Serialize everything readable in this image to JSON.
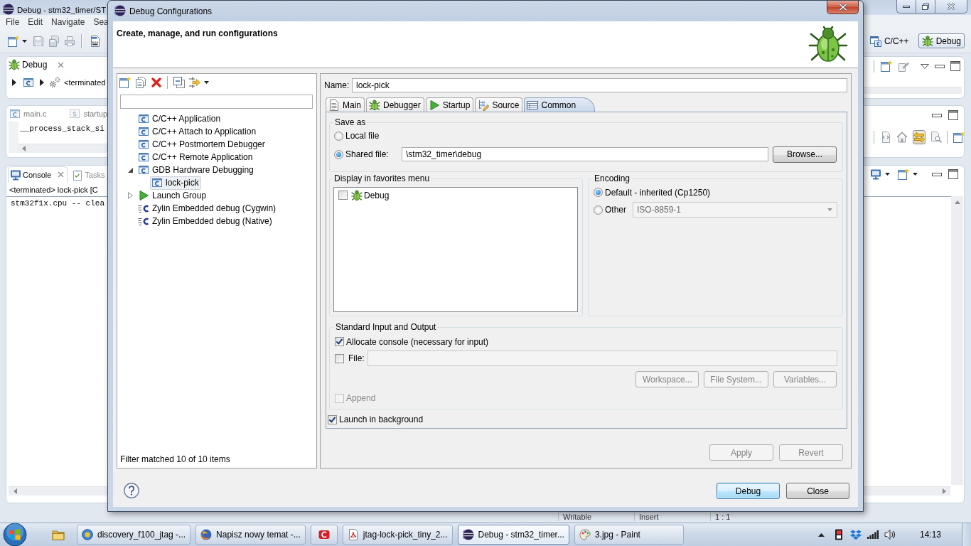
{
  "ide": {
    "title": "Debug - stm32_timer/ST",
    "menu": [
      "File",
      "Edit",
      "Navigate",
      "Sea"
    ],
    "perspectives": [
      {
        "label": "C/C++",
        "selected": false
      },
      {
        "label": "Debug",
        "selected": true
      }
    ],
    "debug_view": {
      "tab": "Debug",
      "breadcrumb": "<terminated"
    },
    "editor": {
      "tabs": [
        "main.c",
        "startup"
      ],
      "code": "__process_stack_si"
    },
    "arrows_toggle": {
      "on": true
    },
    "console": {
      "tabs": [
        {
          "label": "Console",
          "selected": true
        },
        {
          "label": "Tasks",
          "selected": false
        }
      ],
      "header": "<terminated> lock-pick [C",
      "lines": [
        "stm32f1x.cpu -- clea"
      ]
    },
    "status_bar": [
      "Writable",
      "Insert",
      "1 : 1"
    ]
  },
  "dialog": {
    "title": "Debug Configurations",
    "heading": "Create, manage, and run configurations",
    "tree": [
      {
        "label": "C/C++ Application",
        "kind": "cdt",
        "selected": false
      },
      {
        "label": "C/C++ Attach to Application",
        "kind": "cdt",
        "selected": false
      },
      {
        "label": "C/C++ Postmortem Debugger",
        "kind": "cdt",
        "selected": false
      },
      {
        "label": "C/C++ Remote Application",
        "kind": "cdt",
        "selected": false
      },
      {
        "label": "GDB Hardware Debugging",
        "kind": "cdt",
        "expanded": true,
        "selected": false,
        "children": [
          {
            "label": "lock-pick",
            "kind": "cdt",
            "selected": true
          }
        ]
      },
      {
        "label": "Launch Group",
        "kind": "group",
        "expanded": false,
        "selected": false
      },
      {
        "label": "Zylin Embedded debug (Cygwin)",
        "kind": "zylin",
        "selected": false
      },
      {
        "label": "Zylin Embedded debug (Native)",
        "kind": "zylin",
        "selected": false
      }
    ],
    "filter_status": "Filter matched 10 of 10 items",
    "name": {
      "label": "Name:",
      "value": "lock-pick"
    },
    "tabs": [
      {
        "label": "Main",
        "selected": false
      },
      {
        "label": "Debugger",
        "selected": false
      },
      {
        "label": "Startup",
        "selected": false
      },
      {
        "label": "Source",
        "selected": false
      },
      {
        "label": "Common",
        "selected": true
      }
    ],
    "save_as": {
      "title": "Save as",
      "options": [
        {
          "label": "Local file",
          "selected": false
        },
        {
          "label": "Shared file:",
          "selected": true
        }
      ],
      "path": "\\stm32_timer\\debug",
      "browse": "Browse..."
    },
    "favorites": {
      "title": "Display in favorites menu",
      "items": [
        {
          "label": "Debug",
          "checked": false
        }
      ]
    },
    "encoding": {
      "title": "Encoding",
      "options": [
        {
          "label": "Default - inherited (Cp1250)",
          "selected": true
        },
        {
          "label": "Other",
          "selected": false
        }
      ],
      "other_value": "ISO-8859-1"
    },
    "std_io": {
      "title": "Standard Input and Output",
      "allocate": {
        "label": "Allocate console (necessary for input)",
        "checked": true
      },
      "file": {
        "label": "File:",
        "checked": false
      },
      "buttons": [
        "Workspace...",
        "File System...",
        "Variables..."
      ],
      "append": {
        "label": "Append",
        "checked": false
      }
    },
    "background": {
      "label": "Launch in background",
      "checked": true
    },
    "apply_buttons": [
      {
        "label": "Apply",
        "disabled": true
      },
      {
        "label": "Revert",
        "disabled": true
      }
    ],
    "footer_buttons": [
      {
        "label": "Debug",
        "default": true
      },
      {
        "label": "Close",
        "default": false
      }
    ]
  },
  "taskbar": {
    "items": [
      {
        "label": "discovery_f100_jtag -...",
        "selected": false
      },
      {
        "label": "Napisz nowy temat -...",
        "selected": false
      },
      {
        "selected": false
      },
      {
        "label": "jtag-lock-pick_tiny_2...",
        "selected": false
      },
      {
        "label": "Debug - stm32_timer...",
        "selected": true
      },
      {
        "label": "3.jpg - Paint",
        "selected": false
      }
    ],
    "clock": "14:13"
  }
}
